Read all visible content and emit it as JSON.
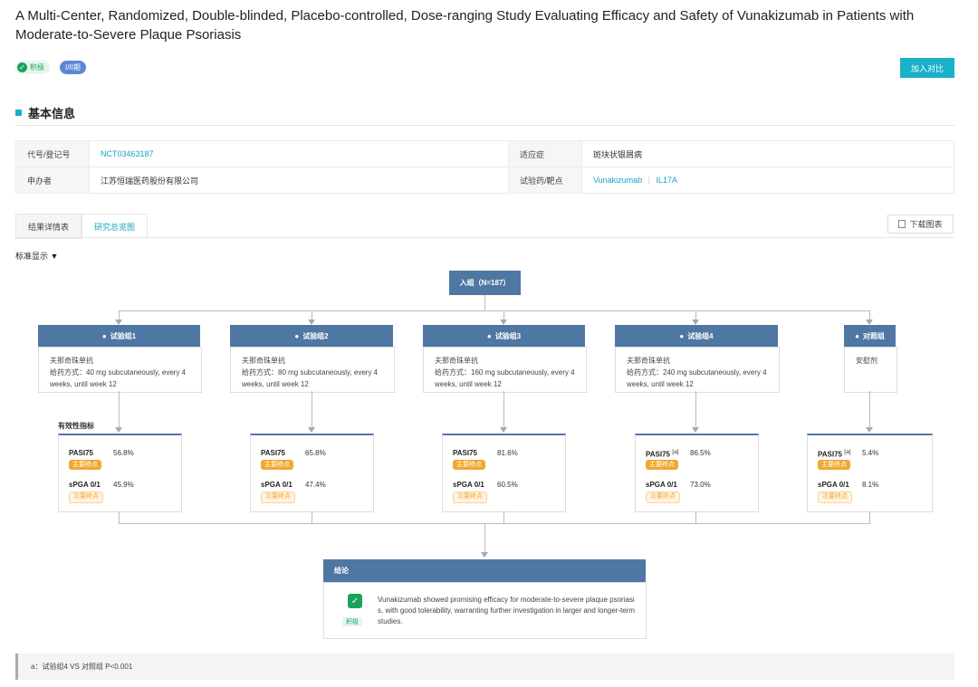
{
  "title": "A Multi-Center, Randomized, Double-blinded, Placebo-controlled, Dose-ranging Study Evaluating Efficacy and Safety of Vunakizumab in Patients with Moderate-to-Severe Plaque Psoriasis",
  "badges": {
    "positive": "积极",
    "phase": "I/II期"
  },
  "compare_button": "加入对比",
  "section_title": "基本信息",
  "info": {
    "code_label": "代号/登记号",
    "code_value": "NCT03463187",
    "indication_label": "适应症",
    "indication_value": "斑块状银屑病",
    "sponsor_label": "申办者",
    "sponsor_value": "江苏恒瑞医药股份有限公司",
    "drug_label": "试验药/靶点",
    "drug_value": "Vunakizumab",
    "target_value": "IL17A"
  },
  "tabs": [
    "结果详情表",
    "研究总览图"
  ],
  "download_button": "下载图表",
  "display_mode": "标准显示",
  "enroll": "入组（N=187）",
  "arms": [
    {
      "name": "试验组1",
      "drug": "夫那奇珠单抗",
      "dosing": "给药方式：40 mg subcutaneously, every 4 weeks, until week 12"
    },
    {
      "name": "试验组2",
      "drug": "夫那奇珠单抗",
      "dosing": "给药方式：80 mg subcutaneously, every 4 weeks, until week 12"
    },
    {
      "name": "试验组3",
      "drug": "夫那奇珠单抗",
      "dosing": "给药方式：160 mg subcutaneously, every 4 weeks, until week 12"
    },
    {
      "name": "试验组4",
      "drug": "夫那奇珠单抗",
      "dosing": "给药方式：240 mg subcutaneously, every 4 weeks, until week 12"
    },
    {
      "name": "对照组",
      "drug": "安慰剂",
      "dosing": ""
    }
  ],
  "efficacy_label": "有效性指标",
  "results": [
    {
      "m1": "PASI75",
      "sup": "",
      "v1": "56.8%",
      "m2": "sPGA 0/1",
      "v2": "45.9%"
    },
    {
      "m1": "PASI75",
      "sup": "",
      "v1": "65.8%",
      "m2": "sPGA 0/1",
      "v2": "47.4%"
    },
    {
      "m1": "PASI75",
      "sup": "",
      "v1": "81.6%",
      "m2": "sPGA 0/1",
      "v2": "60.5%"
    },
    {
      "m1": "PASI75",
      "sup": "[a]",
      "v1": "86.5%",
      "m2": "sPGA 0/1",
      "v2": "73.0%"
    },
    {
      "m1": "PASI75",
      "sup": "[a]",
      "v1": "5.4%",
      "m2": "sPGA 0/1",
      "v2": "8.1%"
    }
  ],
  "primary_tag": "主要终点",
  "secondary_tag": "次要终点",
  "conclusion_title": "结论",
  "conclusion_badge": "积极",
  "conclusion_text": "Vunakizumab showed promising efficacy for moderate-to-severe plaque psoriasis, with good tolerability, warranting further investigation in larger and longer-term studies.",
  "footnote": "a：试验组4 VS 对照组 P<0.001",
  "colors": {
    "accent": "#19b0c8",
    "header": "#4f77a3",
    "primary_tag": "#f0a830",
    "positive": "#19a35c"
  }
}
